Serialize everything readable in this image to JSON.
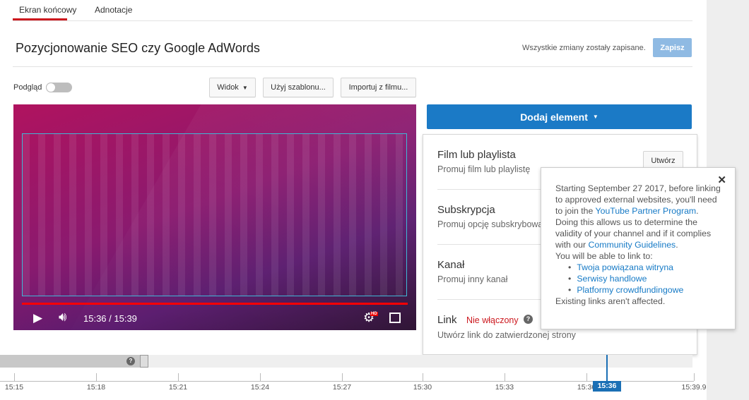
{
  "tabs": [
    {
      "label": "Ekran końcowy",
      "active": true
    },
    {
      "label": "Adnotacje",
      "active": false
    }
  ],
  "title": "Pozycjonowanie SEO czy Google AdWords",
  "save_status": "Wszystkie zmiany zostały zapisane.",
  "save_label": "Zapisz",
  "preview_label": "Podgląd",
  "preview_on": false,
  "toolbar": {
    "view": "Widok",
    "template": "Użyj szablonu...",
    "import": "Importuj z filmu..."
  },
  "player": {
    "time": "15:36 / 15:39",
    "progress_percent": 99,
    "hd_badge": "HD"
  },
  "add_element": "Dodaj element",
  "elements": [
    {
      "title": "Film lub playlista",
      "desc": "Promuj film lub playlistę",
      "action": "Utwórz"
    },
    {
      "title": "Subskrypcja",
      "desc": "Promuj opcję subskrybowania"
    },
    {
      "title": "Kanał",
      "desc": "Promuj inny kanał"
    },
    {
      "title": "Link",
      "status": "Nie włączony",
      "desc": "Utwórz link do zatwierdzonej strony"
    }
  ],
  "tooltip": {
    "p1": "Starting September 27 2017, before linking to approved external websites, you'll need to join the ",
    "link1": "YouTube Partner Program",
    "p2": ". Doing this allows us to determine the validity of your channel and if it complies with our ",
    "link2": "Community Guidelines",
    "p3": ".",
    "intro": "You will be able to link to:",
    "items": [
      "Twoja powiązana witryna",
      "Serwisy handlowe",
      "Platformy crowdfundingowe"
    ],
    "outro": "Existing links aren't affected."
  },
  "timeline": {
    "ticks": [
      "15:15",
      "15:18",
      "15:21",
      "15:24",
      "15:27",
      "15:30",
      "15:33",
      "15:36",
      "15:39.9"
    ],
    "playhead": "15:36"
  },
  "colors": {
    "accent": "#1b7ac6",
    "tab_underline": "#cc181e",
    "status_off": "#cc181e"
  }
}
